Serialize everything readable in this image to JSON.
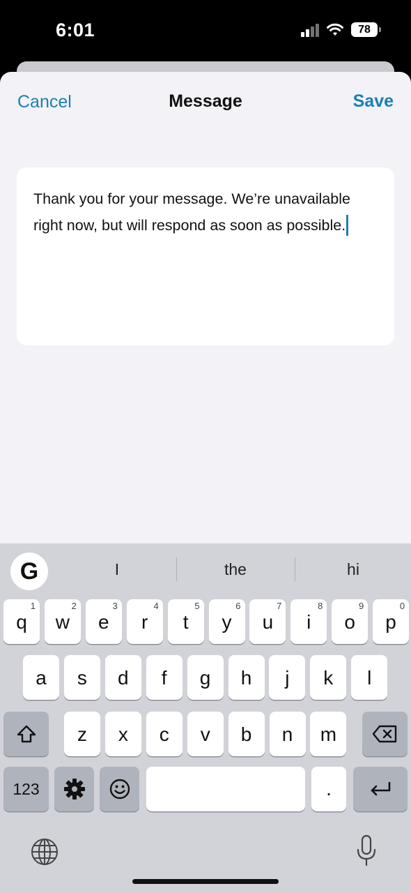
{
  "status_bar": {
    "time": "6:01",
    "battery": "78"
  },
  "nav": {
    "cancel": "Cancel",
    "title": "Message",
    "save": "Save"
  },
  "message": {
    "text": "Thank you for your message. We’re unavailable right now, but will respond as soon as possible."
  },
  "keyboard": {
    "logo": "G",
    "suggestions": [
      "I",
      "the",
      "hi"
    ],
    "row1": [
      {
        "key": "q",
        "num": "1"
      },
      {
        "key": "w",
        "num": "2"
      },
      {
        "key": "e",
        "num": "3"
      },
      {
        "key": "r",
        "num": "4"
      },
      {
        "key": "t",
        "num": "5"
      },
      {
        "key": "y",
        "num": "6"
      },
      {
        "key": "u",
        "num": "7"
      },
      {
        "key": "i",
        "num": "8"
      },
      {
        "key": "o",
        "num": "9"
      },
      {
        "key": "p",
        "num": "0"
      }
    ],
    "row2": [
      "a",
      "s",
      "d",
      "f",
      "g",
      "h",
      "j",
      "k",
      "l"
    ],
    "row3": [
      "z",
      "x",
      "c",
      "v",
      "b",
      "n",
      "m"
    ],
    "numbers_key": "123",
    "period_key": ".",
    "icons": {
      "shift": "shift-icon",
      "backspace": "backspace-icon",
      "settings": "gear-icon",
      "emoji": "emoji-icon",
      "return": "return-icon",
      "globe": "globe-icon",
      "mic": "microphone-icon"
    }
  }
}
